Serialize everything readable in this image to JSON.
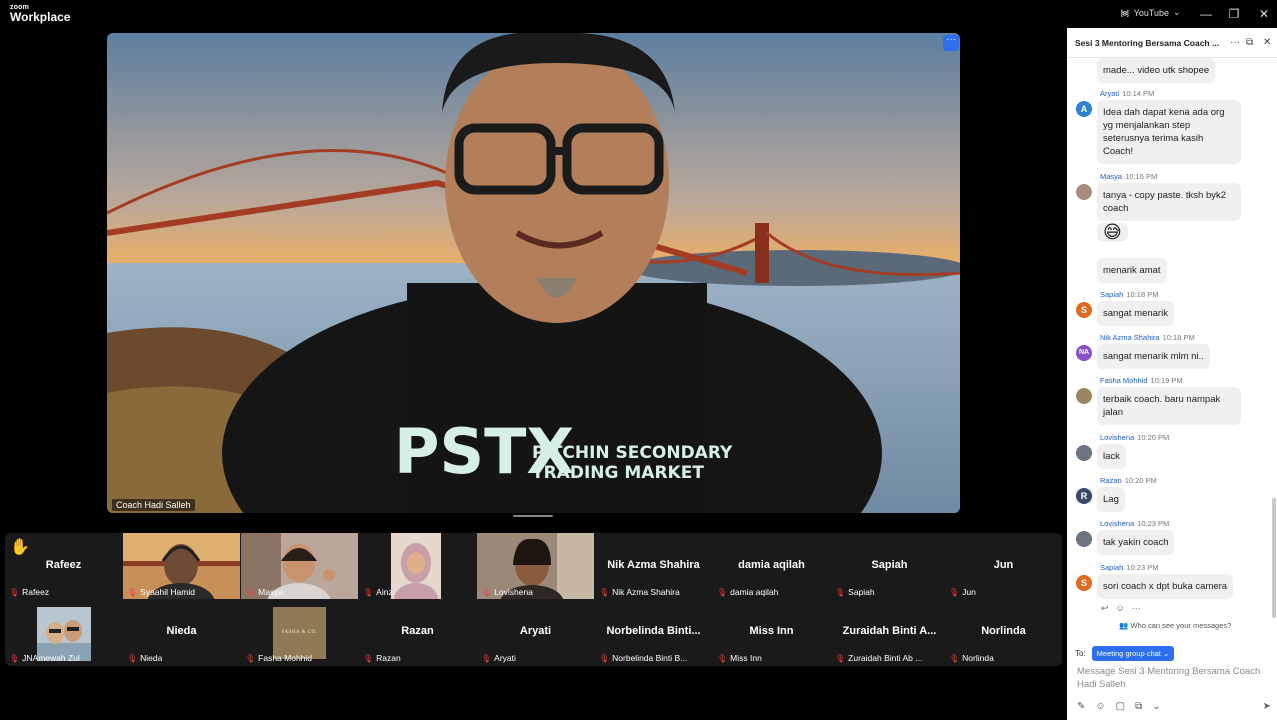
{
  "app": {
    "logo_line1": "zoom",
    "logo_line2": "Workplace"
  },
  "titlebar": {
    "share_label": "YouTube",
    "minimize": "—",
    "restore": "❐",
    "close": "✕"
  },
  "main_video": {
    "name": "Coach Hadi Salleh",
    "more": "···",
    "shirt_text_big": "PSTX",
    "shirt_text_l1": "PITCHIN SECONDARY",
    "shirt_text_l2": "TRADING MARKET"
  },
  "gallery": {
    "hand_icon": "✋",
    "row1": [
      {
        "big": "Rafeez",
        "name": "Rafeez"
      },
      {
        "big": "",
        "name": "Syaahil Hamid"
      },
      {
        "big": "",
        "name": "Masya"
      },
      {
        "big": "",
        "name": "Ainz"
      },
      {
        "big": "",
        "name": "Lovishena"
      },
      {
        "big": "Nik Azma Shahira",
        "name": "Nik Azma Shahira"
      },
      {
        "big": "damia aqilah",
        "name": "damia aqilah"
      },
      {
        "big": "Sapiah",
        "name": "Sapiah"
      },
      {
        "big": "Jun",
        "name": "Jun"
      }
    ],
    "row2": [
      {
        "big": "",
        "name": "JNAmewah Zul"
      },
      {
        "big": "Nieda",
        "name": "Nieda"
      },
      {
        "big": "",
        "name": "Fasha Mohhid",
        "logo_text": "FASHA & CO."
      },
      {
        "big": "Razan",
        "name": "Razan"
      },
      {
        "big": "Aryati",
        "name": "Aryati"
      },
      {
        "big": "Norbelinda  Binti...",
        "name": "Norbelinda Binti B..."
      },
      {
        "big": "Miss Inn",
        "name": "Miss Inn"
      },
      {
        "big": "Zuraidah Binti A...",
        "name": "Zuraidah Binti Ab ..."
      },
      {
        "big": "Norlinda",
        "name": "Norlinda"
      }
    ]
  },
  "chat": {
    "title": "Sesi 3 Mentoring Bersama Coach ...",
    "header_icons": {
      "more": "···",
      "popout": "⧉",
      "close": "✕"
    },
    "messages": [
      {
        "sender": "",
        "time": "",
        "text": "made... video utk shopee"
      },
      {
        "sender": "Aryati",
        "time": "10:14 PM",
        "avatar": "A",
        "text": "Idea dah dapat kena ada org yg menjalankan step seterusnya  terima kasih Coach!"
      },
      {
        "sender": "Masya",
        "time": "10:16 PM",
        "text": "tanya - copy paste. tksh byk2 coach"
      },
      {
        "sender": "",
        "time": "",
        "text": "😅"
      },
      {
        "sender": "",
        "time": "",
        "text": "menarik amat"
      },
      {
        "sender": "Sapiah",
        "time": "10:18 PM",
        "avatar": "S",
        "text": "sangat menarik"
      },
      {
        "sender": "Nik Azma Shahira",
        "time": "10:18 PM",
        "avatar": "NA",
        "text": "sangat menarik mlm ni.."
      },
      {
        "sender": "Fasha Mohhid",
        "time": "10:19 PM",
        "text": "terbaik coach. baru nampak jalan"
      },
      {
        "sender": "Lovishena",
        "time": "10:20 PM",
        "text": "lack"
      },
      {
        "sender": "Razan",
        "time": "10:20 PM",
        "avatar": "R",
        "text": "Lag"
      },
      {
        "sender": "Lovishena",
        "time": "10:23 PM",
        "text": "tak yakin coach"
      },
      {
        "sender": "Sapiah",
        "time": "10:23 PM",
        "avatar": "S",
        "text": "sori coach x dpt buka camera"
      }
    ],
    "who_can_see": "Who can see your messages?",
    "to_label": "To:",
    "to_value": "Meeting group chat",
    "compose_placeholder": "Message Sesi 3 Mentoring Bersama Coach Hadi Salleh"
  },
  "colors": {
    "accent": "#2d6ff0",
    "mic_muted": "#e8423f"
  }
}
